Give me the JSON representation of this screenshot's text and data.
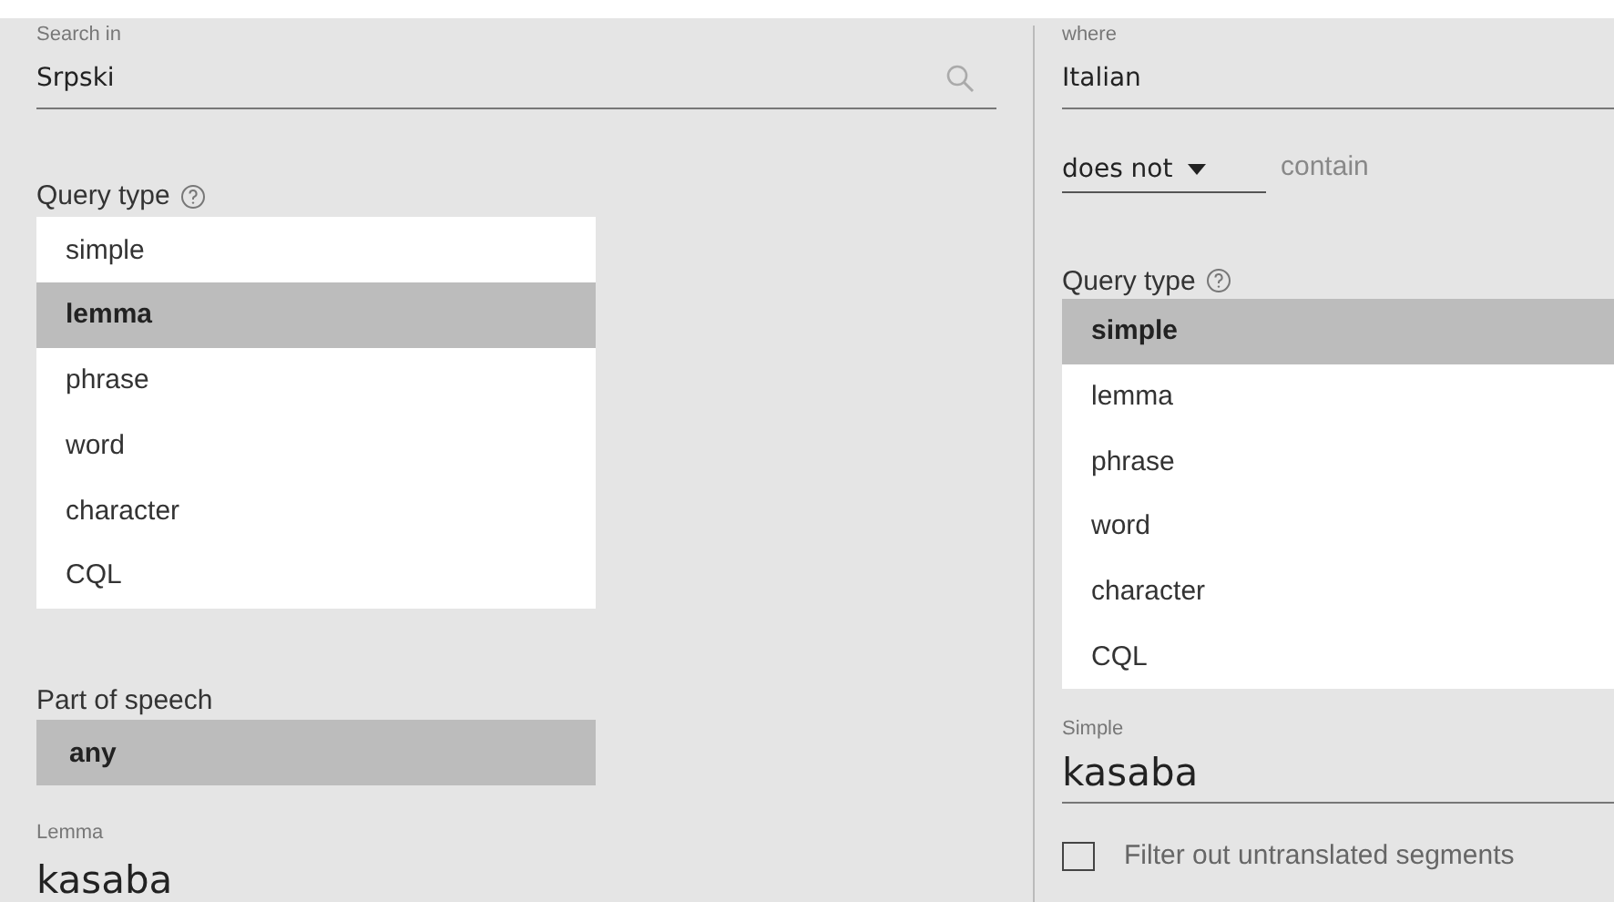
{
  "left": {
    "search_in": {
      "label": "Search in",
      "value": "Srpski"
    },
    "query_type": {
      "label": "Query type",
      "options": [
        {
          "label": "simple",
          "selected": false
        },
        {
          "label": "lemma",
          "selected": true
        },
        {
          "label": "phrase",
          "selected": false
        },
        {
          "label": "word",
          "selected": false
        },
        {
          "label": "character",
          "selected": false
        },
        {
          "label": "CQL",
          "selected": false
        }
      ]
    },
    "part_of_speech": {
      "label": "Part of speech",
      "value": "any"
    },
    "query": {
      "label": "Lemma",
      "value": "kasaba"
    }
  },
  "right": {
    "where": {
      "label": "where",
      "value": "Italian"
    },
    "condition": {
      "value": "does not",
      "suffix": "contain"
    },
    "query_type": {
      "label": "Query type",
      "options": [
        {
          "label": "simple",
          "selected": true
        },
        {
          "label": "lemma",
          "selected": false
        },
        {
          "label": "phrase",
          "selected": false
        },
        {
          "label": "word",
          "selected": false
        },
        {
          "label": "character",
          "selected": false
        },
        {
          "label": "CQL",
          "selected": false
        }
      ]
    },
    "query": {
      "label": "Simple",
      "value": "kasaba"
    },
    "filter": {
      "label": "Filter out untranslated segments",
      "checked": false
    }
  }
}
